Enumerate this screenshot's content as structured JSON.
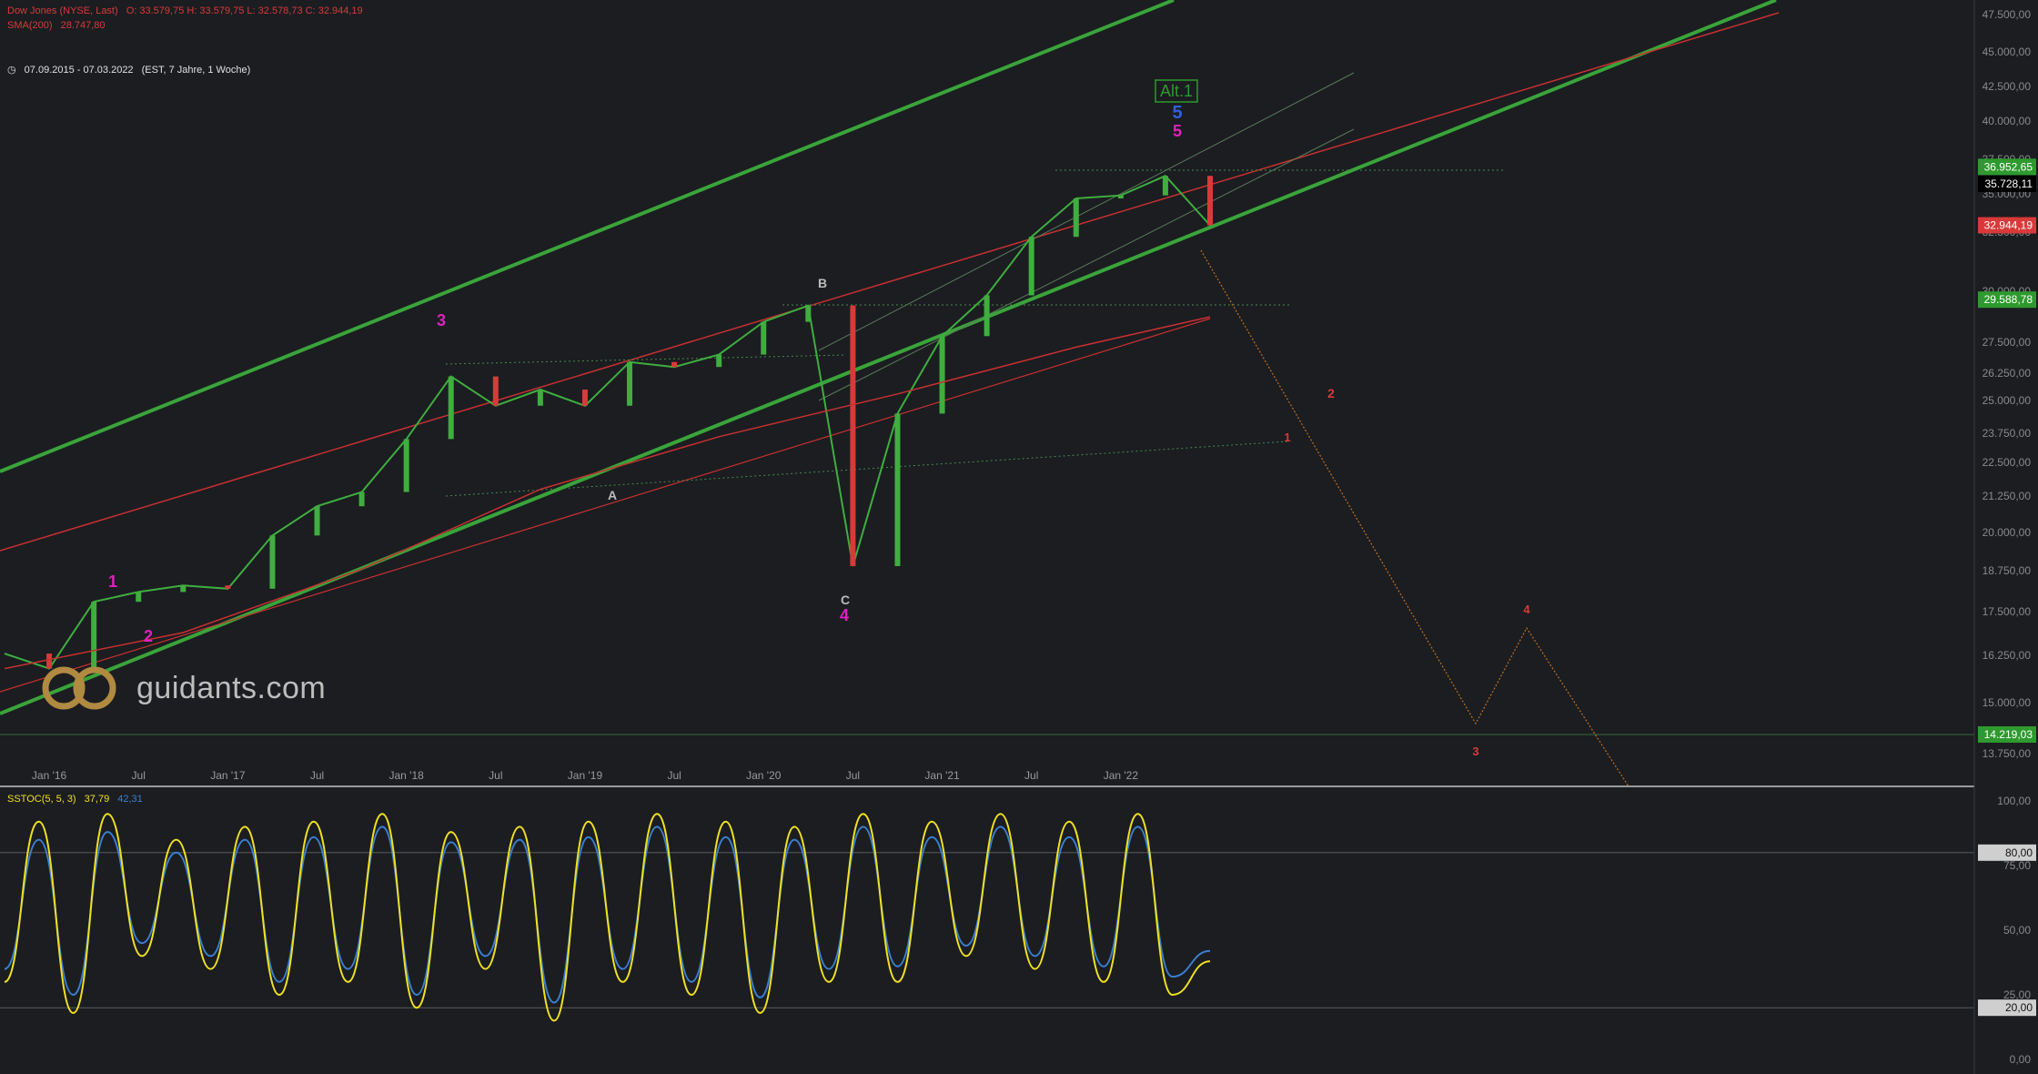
{
  "header": {
    "symbol": "Dow Jones (NYSE, Last)",
    "ohlc": "O: 33.579,75  H: 33.579,75  L: 32.578,73  C: 32.944,19",
    "sma_label": "SMA(200)",
    "sma_value": "28.747,80",
    "period": "07.09.2015 - 07.03.2022",
    "period_detail": "(EST, 7 Jahre, 1 Woche)"
  },
  "watermark": "guidants.com",
  "colors": {
    "background": "#1b1d21",
    "up_candle": "#3fae3f",
    "down_candle": "#d83a3a",
    "channel_green": "#3aa43a",
    "channel_red": "#c83030",
    "stoch_k": "#f0e020",
    "stoch_d": "#3a7fd0"
  },
  "chart_data": [
    {
      "type": "line",
      "title": "Dow Jones (NYSE, Last)",
      "x_tick_labels": [
        "Jan '16",
        "Jul",
        "Jan '17",
        "Jul",
        "Jan '18",
        "Jul",
        "Jan '19",
        "Jul",
        "Jan '20",
        "Jul",
        "Jan '21",
        "Jul",
        "Jan '22"
      ],
      "y_tick_labels": [
        "47.500,00",
        "45.000,00",
        "42.500,00",
        "40.000,00",
        "37.500,00",
        "35.000,00",
        "32.500,00",
        "30.000,00",
        "27.500,00",
        "26.250,00",
        "25.000,00",
        "23.750,00",
        "22.500,00",
        "21.250,00",
        "20.000,00",
        "18.750,00",
        "17.500,00",
        "16.250,00",
        "15.000,00",
        "13.750,00"
      ],
      "y_tick_values": [
        47500,
        45000,
        42500,
        40000,
        37500,
        35000,
        32500,
        30000,
        27500,
        26250,
        25000,
        23750,
        22500,
        21250,
        20000,
        18750,
        17500,
        16250,
        15000,
        13750
      ],
      "price_badges": [
        {
          "label": "36.952,65",
          "color": "#2e9a2e"
        },
        {
          "label": "35.728,11",
          "color": "#000000"
        },
        {
          "label": "32.944,19",
          "color": "#d83a3a"
        },
        {
          "label": "29.588,78",
          "color": "#2e9a2e"
        },
        {
          "label": "14.219,03",
          "color": "#2e9a2e"
        }
      ],
      "series": [
        {
          "name": "Dow Jones (NYSE, Last)",
          "x": [
            0,
            13,
            26,
            39,
            52,
            65,
            78,
            91,
            104,
            117,
            130,
            143,
            156,
            169,
            182,
            195,
            208,
            221,
            234,
            247,
            260,
            273,
            286,
            299,
            312,
            325,
            338,
            351
          ],
          "values": [
            16300,
            15900,
            17800,
            18100,
            18300,
            18200,
            19900,
            20900,
            21400,
            23500,
            26100,
            24800,
            25500,
            24800,
            26700,
            26500,
            27000,
            28500,
            29300,
            18900,
            24500,
            27800,
            29800,
            32300,
            34700,
            34900,
            36300,
            32944
          ]
        },
        {
          "name": "SMA(200)",
          "x": [
            0,
            52,
            104,
            156,
            208,
            260,
            312,
            351
          ],
          "values": [
            15900,
            16900,
            18800,
            21500,
            23600,
            25300,
            27300,
            28747
          ]
        }
      ],
      "annotations": [
        "1",
        "2",
        "3",
        "4",
        "5",
        "A",
        "B",
        "C",
        "Alt.1"
      ]
    },
    {
      "type": "line",
      "title": "SSTOC(5, 5, 3)",
      "value_k": "37,79",
      "value_d": "42,31",
      "y_tick_labels": [
        "100,00",
        "75,00",
        "50,00",
        "25,00",
        "0,00"
      ],
      "y_tick_values": [
        100,
        75,
        50,
        25,
        0
      ],
      "level_badges": [
        "80,00",
        "20,00"
      ],
      "levels": [
        80,
        20
      ],
      "series": [
        {
          "name": "%K",
          "x": [
            0,
            10,
            20,
            30,
            40,
            50,
            60,
            70,
            80,
            90,
            100,
            110,
            120,
            130,
            140,
            150,
            160,
            170,
            180,
            190,
            200,
            210,
            220,
            230,
            240,
            250,
            260,
            270,
            280,
            290,
            300,
            310,
            320,
            330,
            340,
            351
          ],
          "values": [
            30,
            92,
            18,
            95,
            40,
            85,
            35,
            90,
            25,
            92,
            30,
            95,
            20,
            88,
            35,
            90,
            15,
            92,
            30,
            95,
            25,
            92,
            18,
            90,
            30,
            95,
            30,
            92,
            40,
            95,
            35,
            92,
            30,
            95,
            25,
            38
          ]
        },
        {
          "name": "%D",
          "x": [
            0,
            10,
            20,
            30,
            40,
            50,
            60,
            70,
            80,
            90,
            100,
            110,
            120,
            130,
            140,
            150,
            160,
            170,
            180,
            190,
            200,
            210,
            220,
            230,
            240,
            250,
            260,
            270,
            280,
            290,
            300,
            310,
            320,
            330,
            340,
            351
          ],
          "values": [
            35,
            85,
            25,
            88,
            45,
            80,
            40,
            85,
            30,
            86,
            35,
            90,
            25,
            84,
            40,
            85,
            22,
            86,
            35,
            90,
            30,
            86,
            24,
            85,
            35,
            90,
            36,
            86,
            44,
            90,
            40,
            86,
            36,
            90,
            32,
            42
          ]
        }
      ]
    }
  ]
}
